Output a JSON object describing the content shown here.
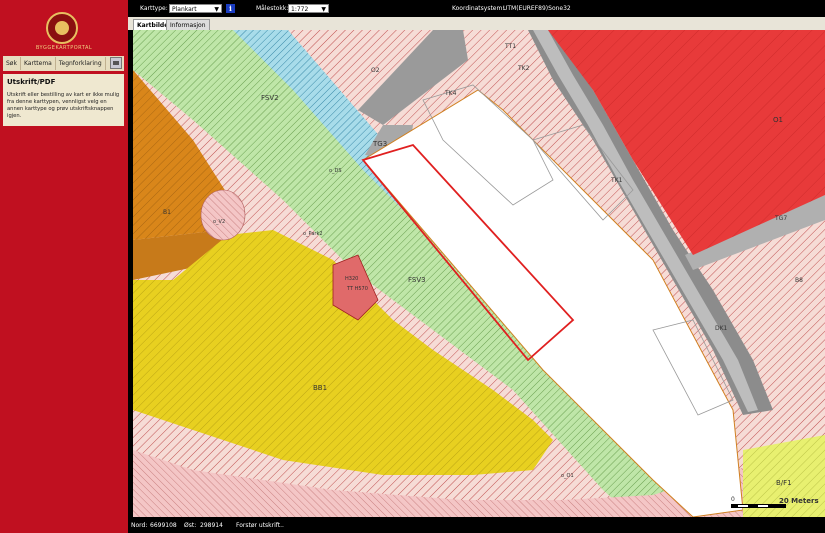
{
  "sidebar": {
    "logo_text": "BYGGEKARTPORTAL",
    "tabs": [
      "Søk",
      "Karttema",
      "Tegnforklaring"
    ],
    "panel_title": "Utskrift/PDF",
    "panel_text": "Utskrift eller bestilling av kart er ikke mulig fra denne karttypen, vennligst velg en annen karttype og prøv utskriftsknappen igjen."
  },
  "topbar": {
    "karttype_label": "Karttype:",
    "karttype_value": "Plankart",
    "malestokk_label": "Målestokk:",
    "malestokk_value": "1:772",
    "koord_label": "Koordinatsystem:",
    "koord_value": "UTM(EUREF89)Sone32"
  },
  "map_tabs": [
    "Kartbilde",
    "Informasjon"
  ],
  "map": {
    "labels": {
      "o1": "O1",
      "o2": "O2",
      "fsv2": "FSV2",
      "fsv3": "FSV3",
      "tt1": "TT1",
      "tk2": "TK2",
      "tk4": "TK4",
      "tg3": "TG3",
      "tk1": "TK1",
      "tg7": "TG7",
      "b8": "B8",
      "b1": "B1",
      "bb1": "BB1",
      "bf1": "B/F1",
      "h320": "H320",
      "h570": "TT H570",
      "ds": "o_DS",
      "v2": "o_V2",
      "park2": "o_Park2",
      "dk1": "DK1",
      "o1b": "o_O1"
    },
    "scale_text": "20 Meters",
    "scale_zero": "0"
  },
  "status": {
    "nord_label": "Nord:",
    "nord_value": "6699108",
    "ost_label": "Øst:",
    "ost_value": "298914",
    "message": "Forstør utskrift.."
  }
}
